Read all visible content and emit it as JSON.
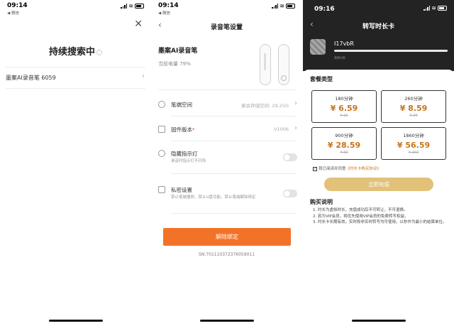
{
  "panel1": {
    "status_time": "09:14",
    "carrier": "◀ 微信",
    "title": "持续搜索中",
    "device_name": "墨案AI录音笔 6059"
  },
  "panel2": {
    "status_time": "09:14",
    "carrier": "◀ 微信",
    "title": "录音笔设置",
    "pen_name": "墨案AI录音笔",
    "battery": "当前电量 79%",
    "rows": [
      {
        "label": "笔端空间",
        "value": "剩余存储空间: 29.25G"
      },
      {
        "label": "固件版本",
        "value": "V1006",
        "badge": "*"
      },
      {
        "label": "隐藏指示灯",
        "desc": "录音时指示灯不闪烁"
      },
      {
        "label": "私密设置",
        "desc": "禁止笔端播放，禁止U盘功能，禁止笔端解除绑定"
      }
    ],
    "unbind_label": "解除绑定",
    "serial": "SN:701110372376059011"
  },
  "panel3": {
    "status_time": "09:16",
    "title": "转写时长卡",
    "username": "I17vbR",
    "user_sub": "剩余0秒",
    "section_title": "套餐类型",
    "packages": [
      {
        "duration": "180分钟",
        "price": "¥ 6.59",
        "original": "¥ 15"
      },
      {
        "duration": "260分钟",
        "price": "¥ 8.59",
        "original": "¥ 20"
      },
      {
        "duration": "900分钟",
        "price": "¥ 28.59",
        "original": "¥ 60"
      },
      {
        "duration": "1860分钟",
        "price": "¥ 56.59",
        "original": "¥ 150"
      }
    ],
    "agree_text": "我已阅读并同意",
    "agree_link": "《时长卡购买协议》",
    "buy_label": "立即充值",
    "notes_title": "购买说明",
    "notes": [
      "1. 时长为虚拟时长，充值成功后不可转让，不可退换。",
      "2. 若为VIP会员，将优先使用VIP会员的免费转写权益。",
      "3. 时长卡长期有效，实时和非实时转写均可使用，以秒作为最小的结算单位。"
    ]
  },
  "colors": {
    "orange": "#f27328",
    "gold": "#e2c178",
    "price": "#c8741b",
    "dark": "#232323"
  }
}
